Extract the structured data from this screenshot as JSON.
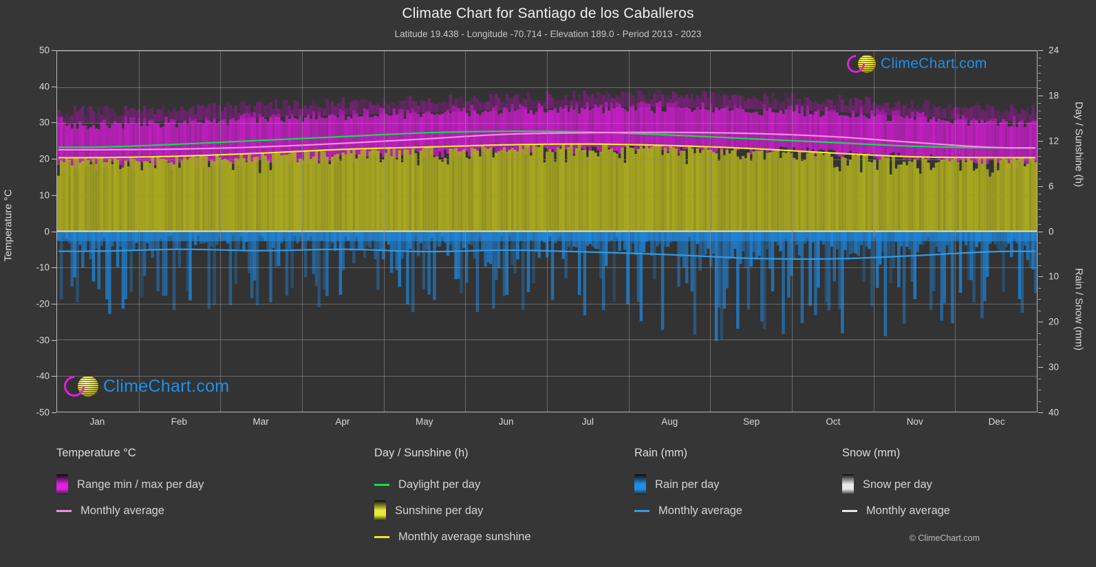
{
  "header": {
    "title": "Climate Chart for Santiago de los Caballeros",
    "subtitle": "Latitude 19.438 - Longitude -70.714 - Elevation 189.0 - Period 2013 - 2023"
  },
  "logo": {
    "text": "ClimeChart.com"
  },
  "copyright": "© ClimeChart.com",
  "axes": {
    "left_title": "Temperature °C",
    "right_title_top": "Day / Sunshine (h)",
    "right_title_bottom": "Rain / Snow (mm)",
    "left_ticks": [
      "50",
      "40",
      "30",
      "20",
      "10",
      "0",
      "-10",
      "-20",
      "-30",
      "-40",
      "-50"
    ],
    "right_ticks_top": [
      "24",
      "18",
      "12",
      "6",
      "0"
    ],
    "right_ticks_bottom": [
      "10",
      "20",
      "30",
      "40"
    ],
    "x_ticks": [
      "Jan",
      "Feb",
      "Mar",
      "Apr",
      "May",
      "Jun",
      "Jul",
      "Aug",
      "Sep",
      "Oct",
      "Nov",
      "Dec"
    ]
  },
  "legend": {
    "groups": [
      {
        "title": "Temperature °C",
        "items": [
          {
            "label": "Range min / max per day",
            "marker": "swatch",
            "color": "#e21fe2"
          },
          {
            "label": "Monthly average",
            "marker": "line",
            "color": "#f48ce0"
          }
        ]
      },
      {
        "title": "Day / Sunshine (h)",
        "items": [
          {
            "label": "Daylight per day",
            "marker": "line",
            "color": "#14dd4a"
          },
          {
            "label": "Sunshine per day",
            "marker": "swatch",
            "color": "#e9e93c"
          },
          {
            "label": "Monthly average sunshine",
            "marker": "line",
            "color": "#e8e830"
          }
        ]
      },
      {
        "title": "Rain (mm)",
        "items": [
          {
            "label": "Rain per day",
            "marker": "swatch",
            "color": "#1f8fe8"
          },
          {
            "label": "Monthly average",
            "marker": "line",
            "color": "#2f9ce8"
          }
        ]
      },
      {
        "title": "Snow (mm)",
        "items": [
          {
            "label": "Snow per day",
            "marker": "swatch",
            "color": "#e8e8e8"
          },
          {
            "label": "Monthly average",
            "marker": "line",
            "color": "#e8e8e8"
          }
        ]
      }
    ]
  },
  "chart_data": {
    "type": "area",
    "title": "Climate Chart for Santiago de los Caballeros",
    "subtitle": "Latitude 19.438 - Longitude -70.714 - Elevation 189.0 - Period 2013 - 2023",
    "xlabel": "",
    "ylabel": "Temperature °C",
    "ylim": [
      -50,
      50
    ],
    "y2lim_top_hours": [
      0,
      24
    ],
    "y2lim_bottom_mm": [
      0,
      40
    ],
    "grid": true,
    "legend_position": "below",
    "categories": [
      "Jan",
      "Feb",
      "Mar",
      "Apr",
      "May",
      "Jun",
      "Jul",
      "Aug",
      "Sep",
      "Oct",
      "Nov",
      "Dec"
    ],
    "series": [
      {
        "name": "Monthly average temperature (°C)",
        "color": "#f48ce0",
        "values": [
          22.6,
          22.8,
          23.4,
          24.4,
          25.6,
          26.9,
          27.3,
          27.4,
          27.1,
          26.2,
          24.6,
          23.2
        ]
      },
      {
        "name": "Daily max temperature (°C)",
        "color": "#e21fe2",
        "values": [
          29.5,
          30.0,
          31.0,
          31.8,
          32.4,
          33.2,
          33.8,
          33.9,
          33.4,
          32.6,
          31.2,
          30.0
        ]
      },
      {
        "name": "Daily min temperature (°C)",
        "color": "#e21fe2",
        "values": [
          18.0,
          18.2,
          18.8,
          20.0,
          21.4,
          22.4,
          22.6,
          22.6,
          22.4,
          21.8,
          20.4,
          18.9
        ]
      },
      {
        "name": "Daylight per day (h)",
        "color": "#14dd4a",
        "values": [
          11.2,
          11.6,
          12.1,
          12.6,
          13.1,
          13.3,
          13.2,
          12.8,
          12.3,
          11.8,
          11.3,
          11.1
        ]
      },
      {
        "name": "Monthly average sunshine (h)",
        "color": "#e8e830",
        "values": [
          9.8,
          10.0,
          10.4,
          10.9,
          11.2,
          11.5,
          11.6,
          11.4,
          11.0,
          10.4,
          9.9,
          9.8
        ]
      },
      {
        "name": "Monthly average rain (mm)",
        "color": "#2f9ce8",
        "values": [
          4.4,
          4.0,
          4.3,
          4.0,
          4.5,
          4.2,
          4.6,
          5.2,
          6.0,
          6.1,
          5.4,
          4.5
        ]
      },
      {
        "name": "Monthly average snow (mm)",
        "color": "#e8e8e8",
        "values": [
          0,
          0,
          0,
          0,
          0,
          0,
          0,
          0,
          0,
          0,
          0,
          0
        ]
      }
    ]
  }
}
